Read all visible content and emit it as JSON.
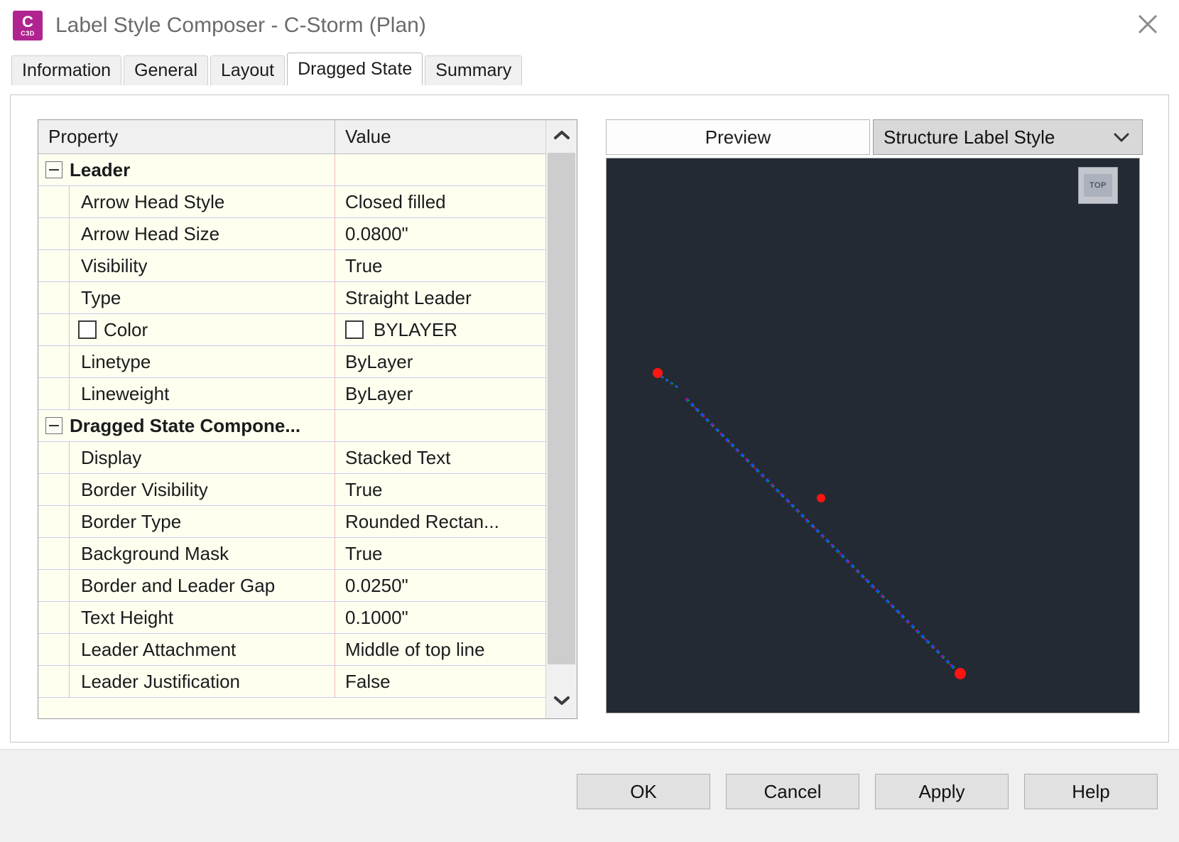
{
  "window": {
    "title": "Label Style Composer - C-Storm (Plan)",
    "app_icon_main": "C",
    "app_icon_sub": "C3D",
    "close_icon": "close-icon"
  },
  "tabs": [
    {
      "label": "Information",
      "active": false
    },
    {
      "label": "General",
      "active": false
    },
    {
      "label": "Layout",
      "active": false
    },
    {
      "label": "Dragged State",
      "active": true
    },
    {
      "label": "Summary",
      "active": false
    }
  ],
  "grid": {
    "columns": {
      "property": "Property",
      "value": "Value"
    },
    "rows": [
      {
        "type": "group",
        "property": "Leader",
        "value": ""
      },
      {
        "type": "item",
        "property": "Arrow Head Style",
        "value": "Closed filled"
      },
      {
        "type": "item",
        "property": "Arrow Head Size",
        "value": "0.0800\""
      },
      {
        "type": "item",
        "property": "Visibility",
        "value": "True"
      },
      {
        "type": "item",
        "property": "Type",
        "value": "Straight Leader"
      },
      {
        "type": "color",
        "property": "Color",
        "value": "BYLAYER",
        "swatch": "#ffffff"
      },
      {
        "type": "item",
        "property": "Linetype",
        "value": "ByLayer"
      },
      {
        "type": "item",
        "property": "Lineweight",
        "value": "ByLayer"
      },
      {
        "type": "group",
        "property": "Dragged State Compone...",
        "value": ""
      },
      {
        "type": "item",
        "property": "Display",
        "value": "Stacked Text"
      },
      {
        "type": "item",
        "property": "Border Visibility",
        "value": "True"
      },
      {
        "type": "item",
        "property": "Border Type",
        "value": "Rounded Rectan..."
      },
      {
        "type": "item",
        "property": "Background Mask",
        "value": "True"
      },
      {
        "type": "item",
        "property": "Border and Leader Gap",
        "value": "0.0250\""
      },
      {
        "type": "item",
        "property": "Text Height",
        "value": "0.1000\"",
        "highlighted": true
      },
      {
        "type": "item",
        "property": "Leader Attachment",
        "value": "Middle of top line"
      },
      {
        "type": "item",
        "property": "Leader Justification",
        "value": "False"
      }
    ],
    "highlight_color": "#ee1c25",
    "scrollbar": {
      "up_icon": "chevron-up-icon",
      "down_icon": "chevron-down-icon"
    }
  },
  "preview": {
    "label": "Preview",
    "style_selected": "Structure Label Style",
    "dropdown_icon": "chevron-down-icon",
    "canvas_background": "#242a33",
    "viewcube_label": "TOP"
  },
  "footer": {
    "buttons": [
      {
        "label": "OK"
      },
      {
        "label": "Cancel"
      },
      {
        "label": "Apply"
      },
      {
        "label": "Help"
      }
    ]
  }
}
